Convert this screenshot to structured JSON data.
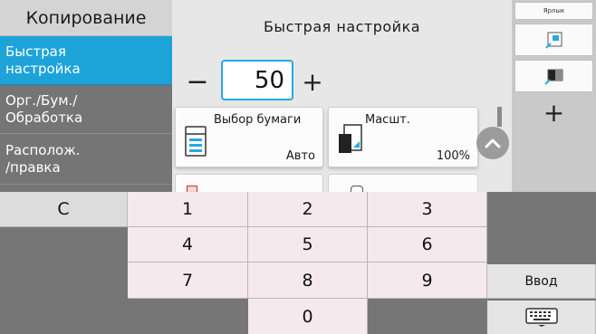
{
  "app": {
    "title": "Копирование"
  },
  "nav": {
    "items": [
      {
        "line1": "Быстрая",
        "line2": "настройка",
        "active": true
      },
      {
        "line1": "Орг./Бум./",
        "line2": "Обработка",
        "active": false
      },
      {
        "line1": "Располож.",
        "line2": "/правка",
        "active": false
      }
    ]
  },
  "main": {
    "title": "Быстрая настройка",
    "copies": {
      "value": "50",
      "minus_label": "−",
      "plus_label": "+"
    },
    "cards": [
      {
        "label": "Выбор бумаги",
        "value": "Авто",
        "icon": "paper-tray-icon"
      },
      {
        "label": "Масшт.",
        "value": "100%",
        "icon": "zoom-icon"
      }
    ]
  },
  "sidebar": {
    "label": "Ярлык",
    "add_label": "+",
    "shortcuts": [
      "shortcut-document-icon",
      "shortcut-color-icon"
    ]
  },
  "keypad": {
    "clear": "C",
    "keys": [
      "1",
      "2",
      "3",
      "4",
      "5",
      "6",
      "7",
      "8",
      "9",
      "0"
    ],
    "enter": "Ввод",
    "keyboard_icon": "keyboard-icon"
  },
  "colors": {
    "accent": "#1ea3d9",
    "nav_bg": "#757575",
    "key_bg": "#f5e9ee"
  }
}
